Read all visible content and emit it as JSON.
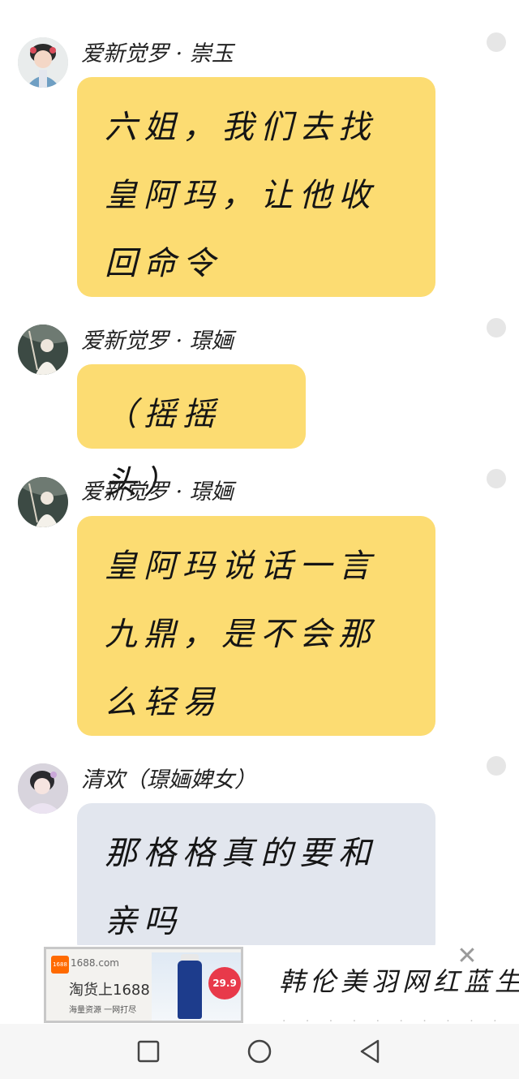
{
  "messages": [
    {
      "sender": "爱新觉罗 · 崇玉",
      "text": "六姐，我们去找皇阿玛，让他收回命令",
      "bubble": "yellow"
    },
    {
      "sender": "爱新觉罗 · 璟婳",
      "text": "（摇摇头）",
      "bubble": "yellow"
    },
    {
      "sender": "爱新觉罗 · 璟婳",
      "text": "皇阿玛说话一言九鼎，是不会那么轻易",
      "bubble": "yellow"
    },
    {
      "sender": "清欢（璟婳婢女）",
      "text": "那格格真的要和亲吗",
      "bubble": "gray"
    }
  ],
  "ad": {
    "brand_logo": "1688",
    "domain": "1688.com",
    "slogan": "淘货上1688",
    "subline": "海量资源 一网打尽",
    "price": "29.9",
    "title": "韩伦美羽网红蓝生"
  },
  "navbar": {
    "icons": [
      "square-recents-icon",
      "circle-home-icon",
      "triangle-back-icon"
    ]
  },
  "colors": {
    "bubble_yellow": "#fcdc72",
    "bubble_gray": "#e2e6ee",
    "navbar_bg": "#f6f6f6"
  }
}
